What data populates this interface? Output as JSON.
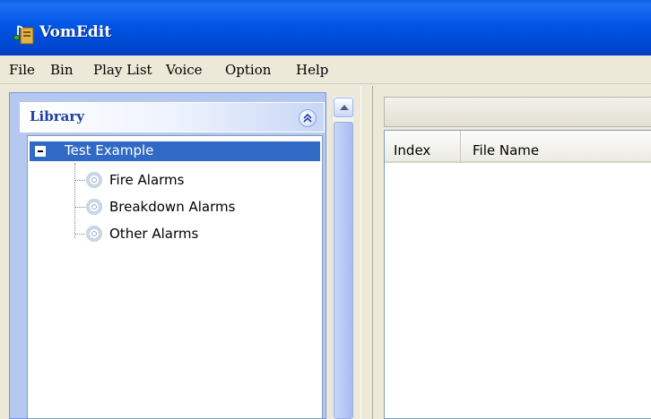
{
  "window": {
    "title": "VomEdit"
  },
  "menu": [
    "File",
    "Bin",
    "Play List",
    "Voice",
    "Option",
    "Help"
  ],
  "library": {
    "title": "Library",
    "tree": {
      "root": "Test Example",
      "children": [
        "Fire Alarms",
        "Breakdown Alarms",
        "Other Alarms"
      ]
    }
  },
  "list": {
    "columns": [
      "Index",
      "File Name"
    ]
  },
  "colors": {
    "titlebar": "#0055e5",
    "selection": "#316ac5",
    "panel": "#b5c8f0",
    "library_title": "#1d3fa3"
  }
}
